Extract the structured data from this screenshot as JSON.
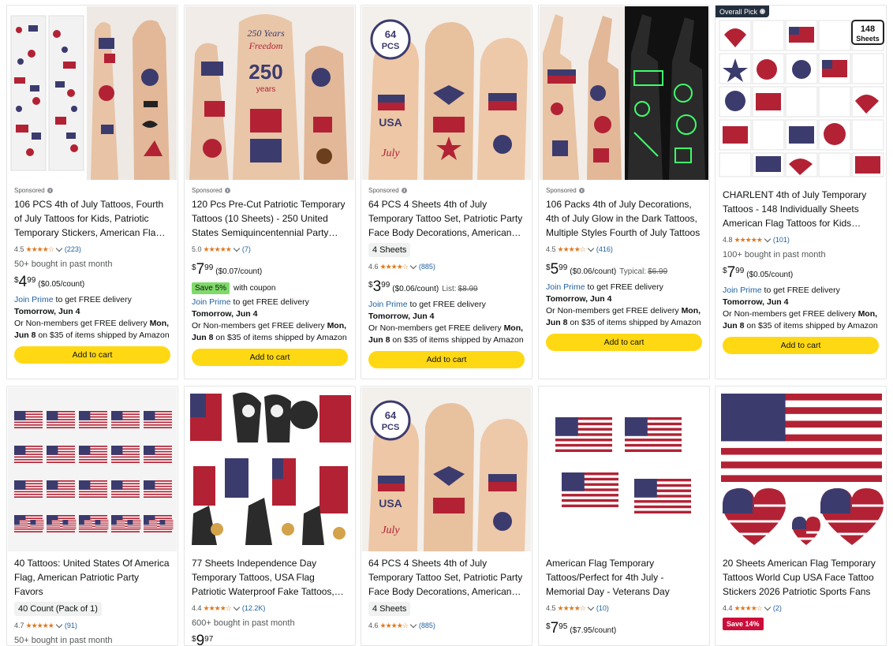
{
  "overall_pick": "Overall Pick",
  "row1": [
    {
      "sponsored": "Sponsored",
      "title": "106 PCS 4th of July Tattoos, Fourth of July Tattoos for Kids, Patriotic Temporary Stickers, American Flag Tattoos",
      "rating": "4.5",
      "stars": "★★★★☆",
      "reviews": "(223)",
      "bought": "50+ bought in past month",
      "price_currency": "$",
      "price_whole": "4",
      "price_fraction": "99",
      "unit_price": "($0.05/count)",
      "prime_link": "Join Prime",
      "prime_text": " to get FREE delivery",
      "delivery_date": "Tomorrow, Jun 4",
      "nonmember_prefix": "Or Non-members get FREE delivery ",
      "nonmember_date": "Mon, Jun 8",
      "nonmember_suffix": " on $35 of items shipped by Amazon",
      "button": "Add to cart"
    },
    {
      "sponsored": "Sponsored",
      "title": "120 Pcs Pre-Cut Patriotic Temporary Tattoos (10 Sheets) - 250 United States Semiquincentennial Party Favors",
      "rating": "5.0",
      "stars": "★★★★★",
      "reviews": "(7)",
      "price_currency": "$",
      "price_whole": "7",
      "price_fraction": "99",
      "unit_price": "($0.07/count)",
      "coupon_badge": "Save 5%",
      "coupon_text": "with coupon",
      "prime_link": "Join Prime",
      "prime_text": " to get FREE delivery",
      "delivery_date": "Tomorrow, Jun 4",
      "nonmember_prefix": "Or Non-members get FREE delivery ",
      "nonmember_date": "Mon, Jun 8",
      "nonmember_suffix": " on $35 of items shipped by Amazon",
      "button": "Add to cart"
    },
    {
      "sponsored": "Sponsored",
      "title": "64 PCS 4 Sheets 4th of July Temporary Tattoo Set, Patriotic Party Face Body Decorations, American Flag",
      "pill": "4 Sheets",
      "rating": "4.6",
      "stars": "★★★★☆",
      "reviews": "(885)",
      "price_currency": "$",
      "price_whole": "3",
      "price_fraction": "99",
      "unit_price": "($0.06/count)",
      "list_label": "List:",
      "list_price": "$8.99",
      "prime_link": "Join Prime",
      "prime_text": " to get FREE delivery",
      "delivery_date": "Tomorrow, Jun 4",
      "nonmember_prefix": "Or Non-members get FREE delivery ",
      "nonmember_date": "Mon, Jun 8",
      "nonmember_suffix": " on $35 of items shipped by Amazon",
      "button": "Add to cart"
    },
    {
      "sponsored": "Sponsored",
      "title": "106 Packs 4th of July Decorations, 4th of July Glow in the Dark Tattoos, Multiple Styles Fourth of July Tattoos",
      "rating": "4.5",
      "stars": "★★★★☆",
      "reviews": "(416)",
      "price_currency": "$",
      "price_whole": "5",
      "price_fraction": "99",
      "unit_price": "($0.06/count)",
      "typical_label": "Typical:",
      "typical_price": "$6.99",
      "prime_link": "Join Prime",
      "prime_text": " to get FREE delivery",
      "delivery_date": "Tomorrow, Jun 4",
      "nonmember_prefix": "Or Non-members get FREE delivery ",
      "nonmember_date": "Mon, Jun 8",
      "nonmember_suffix": " on $35 of items shipped by Amazon",
      "button": "Add to cart"
    },
    {
      "title": "CHARLENT 4th of July Temporary Tattoos - 148 Individually Sheets American Flag Tattoos for Kids Adults",
      "rating": "4.8",
      "stars": "★★★★★",
      "reviews": "(101)",
      "bought": "100+ bought in past month",
      "price_currency": "$",
      "price_whole": "7",
      "price_fraction": "99",
      "unit_price": "($0.05/count)",
      "prime_link": "Join Prime",
      "prime_text": " to get FREE delivery",
      "delivery_date": "Tomorrow, Jun 4",
      "nonmember_prefix": "Or Non-members get FREE delivery ",
      "nonmember_date": "Mon, Jun 8",
      "nonmember_suffix": " on $35 of items shipped by Amazon",
      "button": "Add to cart"
    }
  ],
  "row2": [
    {
      "title": "40 Tattoos: United States Of America Flag, American Patriotic Party Favors",
      "pill": "40 Count (Pack of 1)",
      "rating": "4.7",
      "stars": "★★★★★",
      "reviews": "(91)",
      "bought": "50+ bought in past month"
    },
    {
      "title": "77 Sheets Independence Day Temporary Tattoos, USA Flag Patriotic Waterproof Fake Tattoos, Eagle",
      "rating": "4.4",
      "stars": "★★★★☆",
      "reviews": "(12.2K)",
      "bought": "600+ bought in past month",
      "price_currency": "$",
      "price_whole": "9",
      "price_fraction": "97"
    },
    {
      "title": "64 PCS 4 Sheets 4th of July Temporary Tattoo Set, Patriotic Party Face Body Decorations, American Flag",
      "pill": "4 Sheets",
      "rating": "4.6",
      "stars": "★★★★☆",
      "reviews": "(885)"
    },
    {
      "title": "American Flag Temporary Tattoos/Perfect for 4th July - Memorial Day - Veterans Day",
      "rating": "4.5",
      "stars": "★★★★☆",
      "reviews": "(10)",
      "price_currency": "$",
      "price_whole": "7",
      "price_fraction": "95",
      "unit_price": "($7.95/count)"
    },
    {
      "title": "20 Sheets American Flag Temporary Tattoos World Cup USA Face Tattoo Stickers 2026 Patriotic Sports Fans",
      "rating": "4.4",
      "stars": "★★★★☆",
      "reviews": "(2)",
      "deal_badge": "Save 14%"
    }
  ],
  "badge_text": {
    "pcs_badge_num": "64",
    "pcs_badge_unit": "PCS",
    "sheets_badge_num": "148",
    "sheets_badge_unit": "Sheets",
    "years_line1": "250 Years",
    "years_line2": "Freedom",
    "years_big": "250",
    "years_small": "years",
    "usa": "USA",
    "july": "July"
  },
  "colors": {
    "accent_button": "#ffd814",
    "link": "#2162a1",
    "star": "#de7921",
    "coupon": "#7fda69",
    "deal": "#cc0c39",
    "flag_red": "#b22234",
    "flag_blue": "#3c3b6e"
  }
}
